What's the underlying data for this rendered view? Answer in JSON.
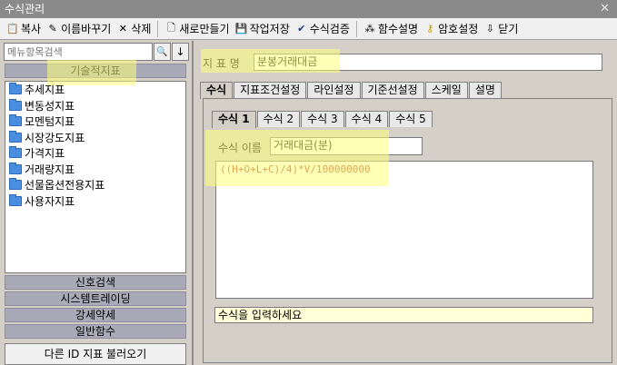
{
  "window": {
    "title": "수식관리",
    "close": "✕"
  },
  "toolbar": {
    "copy": "복사",
    "rename": "이름바꾸기",
    "delete": "삭제",
    "new": "새로만들기",
    "save": "작업저장",
    "verify": "수식검증",
    "func_desc": "함수설명",
    "password": "암호설정",
    "close": "닫기"
  },
  "sidebar": {
    "search_placeholder": "메뉴항목검색",
    "search_icon": "🔍",
    "down_icon": "↓",
    "category_top": "기술적지표",
    "items": [
      {
        "label": "추세지표"
      },
      {
        "label": "변동성지표"
      },
      {
        "label": "모멘텀지표"
      },
      {
        "label": "시장강도지표"
      },
      {
        "label": "가격지표"
      },
      {
        "label": "거래량지표"
      },
      {
        "label": "선물옵션전용지표"
      },
      {
        "label": "사용자지표"
      }
    ],
    "categories": [
      {
        "label": "신호검색"
      },
      {
        "label": "시스템트레이딩"
      },
      {
        "label": "강세약세"
      },
      {
        "label": "일반함수"
      }
    ],
    "load_button": "다른 ID 지표 불러오기"
  },
  "main": {
    "indicator_label": "지 표 명",
    "indicator_name": "분봉거래대금",
    "tabs": [
      {
        "label": "수식"
      },
      {
        "label": "지표조건설정"
      },
      {
        "label": "라인설정"
      },
      {
        "label": "기준선설정"
      },
      {
        "label": "스케일"
      },
      {
        "label": "설명"
      }
    ],
    "formula_tabs": [
      {
        "label": "수식 1"
      },
      {
        "label": "수식 2"
      },
      {
        "label": "수식 3"
      },
      {
        "label": "수식 4"
      },
      {
        "label": "수식 5"
      }
    ],
    "formula_name_label": "수식 이름",
    "formula_name": "거래대금(분)",
    "formula_text": "((H+O+L+C)/4)*V/100000000",
    "hint": "수식을 입력하세요"
  },
  "colors": {
    "formula_text": "#b03a2e",
    "highlight": "#ffff78"
  }
}
